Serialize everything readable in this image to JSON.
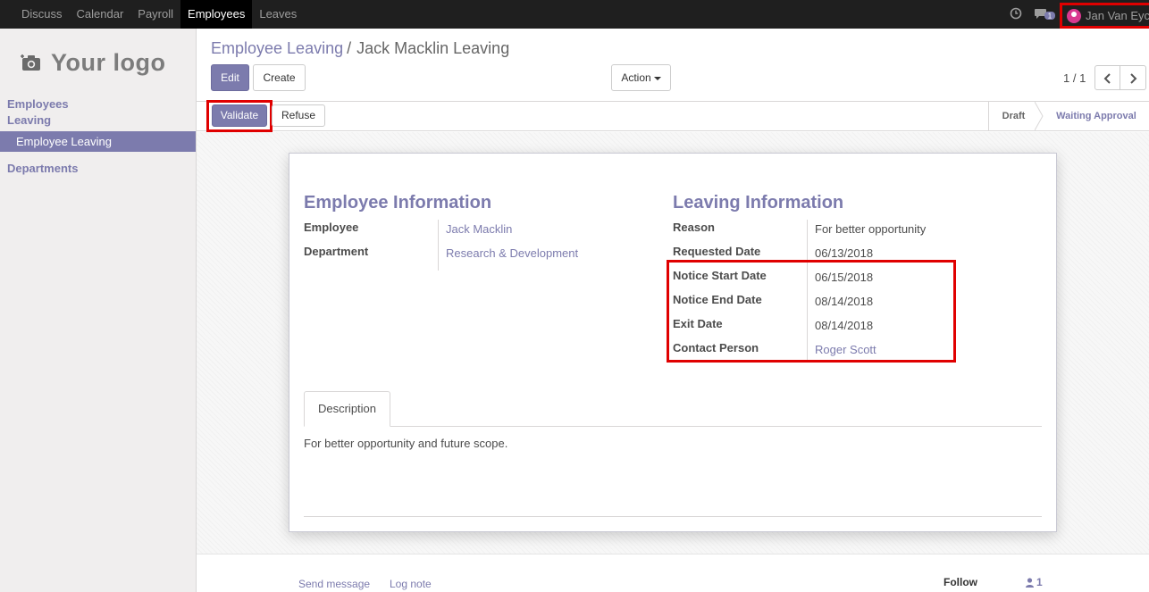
{
  "topbar": {
    "menu": [
      "Discuss",
      "Calendar",
      "Payroll",
      "Employees",
      "Leaves"
    ],
    "active": "Employees",
    "chat_badge": "1",
    "user_name": "Jan Van Eyck"
  },
  "sidebar": {
    "logo_text": "Your logo",
    "section_title": "Employees Leaving",
    "active_item": "Employee Leaving",
    "section2_title": "Departments"
  },
  "breadcrumb": {
    "parent": "Employee Leaving",
    "separator": "/",
    "current": "Jack Macklin Leaving"
  },
  "toolbar": {
    "edit_label": "Edit",
    "create_label": "Create",
    "action_label": "Action",
    "pager": "1 / 1"
  },
  "statusbar": {
    "validate_label": "Validate",
    "refuse_label": "Refuse",
    "stages": [
      "Draft",
      "Waiting Approval"
    ]
  },
  "form": {
    "employee_info": {
      "title": "Employee Information",
      "employee_label": "Employee",
      "employee_value": "Jack Macklin",
      "department_label": "Department",
      "department_value": "Research & Development"
    },
    "leaving_info": {
      "title": "Leaving Information",
      "reason_label": "Reason",
      "reason_value": "For better opportunity",
      "requested_label": "Requested Date",
      "requested_value": "06/13/2018",
      "notice_start_label": "Notice Start Date",
      "notice_start_value": "06/15/2018",
      "notice_end_label": "Notice End Date",
      "notice_end_value": "08/14/2018",
      "exit_label": "Exit Date",
      "exit_value": "08/14/2018",
      "contact_label": "Contact Person",
      "contact_value": "Roger Scott"
    },
    "tab_label": "Description",
    "description": "For better opportunity and future scope."
  },
  "chatter": {
    "send_message": "Send message",
    "log_note": "Log note",
    "follow": "Follow",
    "followers_count": "1"
  },
  "colors": {
    "primary": "#7c7bad",
    "highlight": "#e00000",
    "navbar": "#1f1f1f"
  }
}
